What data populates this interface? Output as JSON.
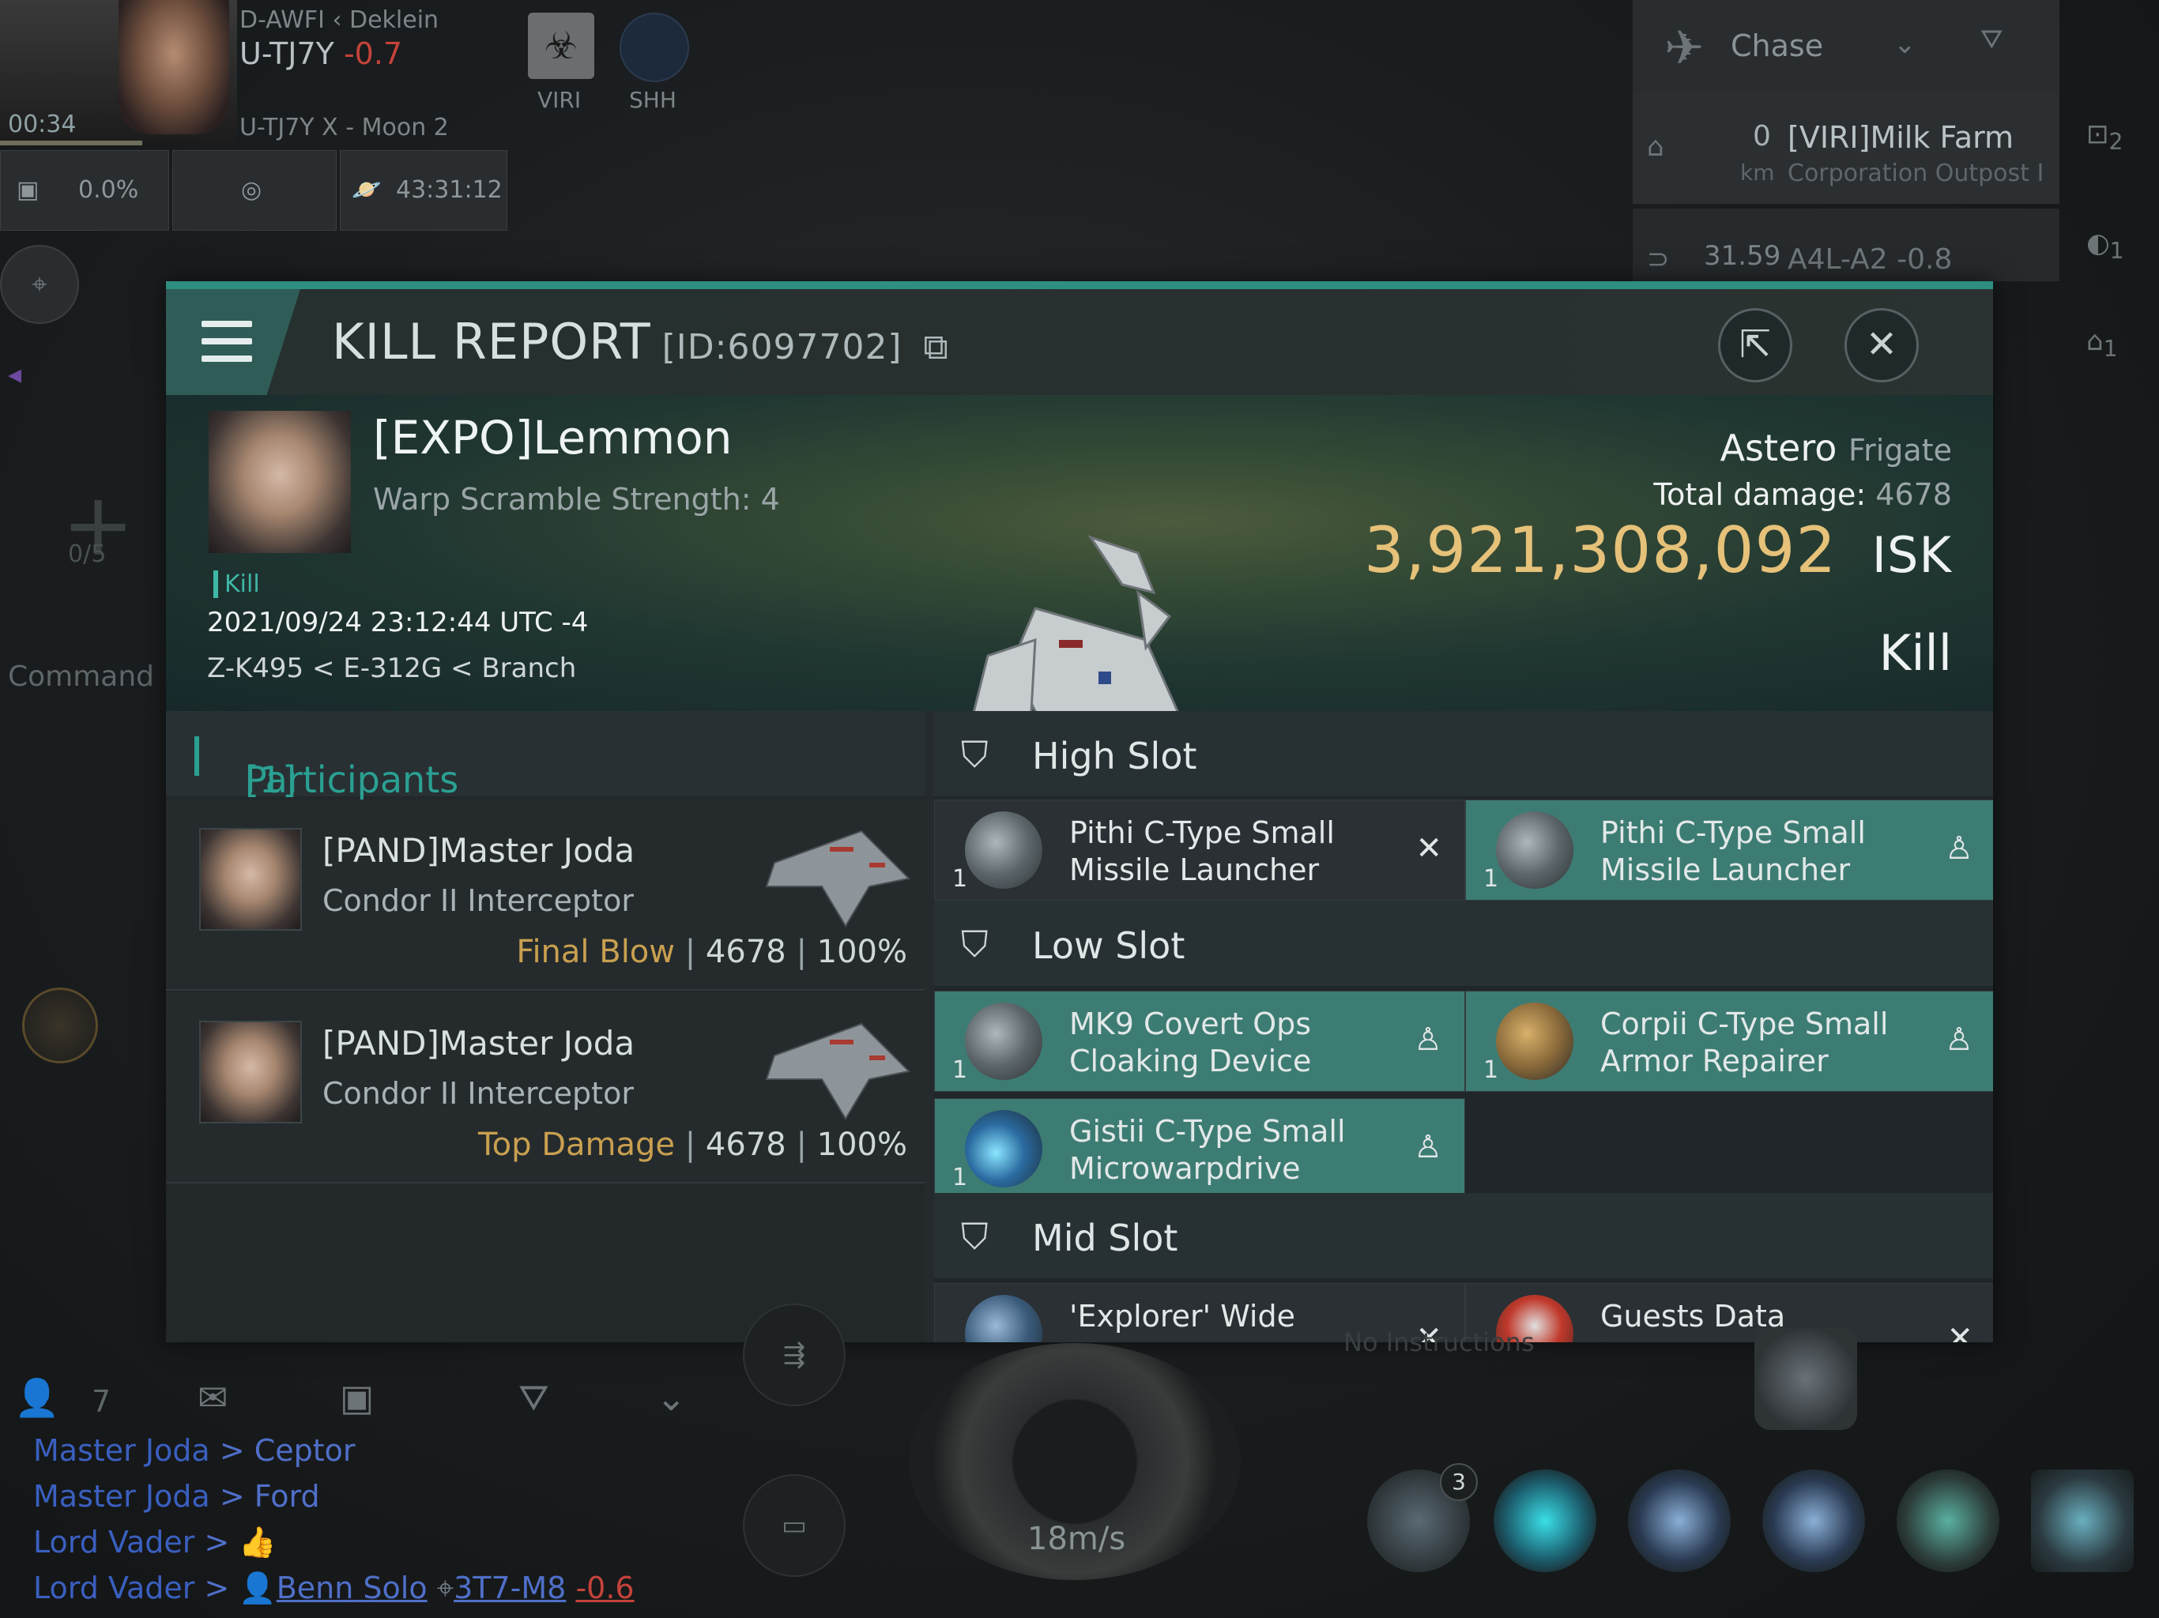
{
  "hud": {
    "region_prev": "D-AWFI",
    "region_next": "Deklein",
    "system": "U-TJ7Y",
    "security": "-0.7",
    "timer": "00:34",
    "location": "U-TJ7Y X - Moon 2",
    "cargo_pct": "0.0%",
    "session_time": "43:31:12",
    "tag1": "VIRI",
    "tag2": "SHH",
    "plus_count": "0/5",
    "command_label": "Command"
  },
  "right_hud": {
    "mode": "Chase",
    "target1_dist": "0",
    "target1_unit": "km",
    "target1_name": "[VIRI]Milk Farm",
    "target1_type": "Corporation Outpost I",
    "target2_dist": "31.59",
    "target2_name": "A4L-A2 -0.8",
    "badge1": "2",
    "badge2": "1",
    "badge3": "1"
  },
  "kill_report": {
    "title": "KILL REPORT",
    "id_text": "[ID:6097702]",
    "victim": {
      "name": "[EXPO]Lemmon",
      "warp_scramble": "Warp Scramble Strength: 4",
      "tag": "Kill",
      "datetime": "2021/09/24 23:12:44 UTC -4",
      "location": "Z-K495 < E-312G < Branch"
    },
    "ship": {
      "name": "Astero",
      "class": "Frigate",
      "total_damage_label": "Total damage:",
      "total_damage": "4678",
      "value": "3,921,308,092",
      "currency": "ISK",
      "result": "Kill"
    },
    "participants": {
      "label": "Participants",
      "count": "[1]",
      "rows": [
        {
          "name": "[PAND]Master Joda",
          "ship": "Condor II Interceptor",
          "role": "Final Blow",
          "damage": "4678",
          "pct": "100%"
        },
        {
          "name": "[PAND]Master Joda",
          "ship": "Condor II Interceptor",
          "role": "Top Damage",
          "damage": "4678",
          "pct": "100%"
        }
      ]
    },
    "slots": {
      "high": {
        "label": "High Slot",
        "modules": [
          {
            "line1": "Pithi C-Type Small",
            "line2": "Missile Launcher",
            "count": "1",
            "state": "destroyed"
          },
          {
            "line1": "Pithi C-Type Small",
            "line2": "Missile Launcher",
            "count": "1",
            "state": "dropped"
          }
        ]
      },
      "low": {
        "label": "Low Slot",
        "modules": [
          {
            "line1": "MK9 Covert Ops",
            "line2": "Cloaking Device",
            "count": "1",
            "state": "dropped"
          },
          {
            "line1": "Corpii C-Type Small",
            "line2": "Armor Repairer",
            "count": "1",
            "state": "dropped"
          },
          {
            "line1": "Gistii C-Type Small",
            "line2": "Microwarpdrive",
            "count": "1",
            "state": "dropped"
          }
        ]
      },
      "mid": {
        "label": "Mid Slot",
        "modules": [
          {
            "line1": "'Explorer' Wide",
            "line2": "",
            "count": "",
            "state": "destroyed"
          },
          {
            "line1": "Guests Data",
            "line2": "",
            "count": "",
            "state": "destroyed"
          }
        ]
      }
    }
  },
  "bottom": {
    "member_count": "7",
    "no_instructions": "No Instructions",
    "speed": "18m/s",
    "module_badge": "3",
    "chat": [
      {
        "from": "Master Joda",
        "sep": ">",
        "to": "Ceptor"
      },
      {
        "from": "Master Joda",
        "sep": ">",
        "to": "Ford"
      },
      {
        "from": "Lord Vader",
        "sep": ">",
        "to": ""
      },
      {
        "from": "Lord Vader",
        "sep": ">",
        "to": "Benn Solo",
        "sys": "3T7-M8",
        "sec": "-0.6"
      }
    ]
  },
  "colors": {
    "accent_teal": "#2e8e80",
    "isk_gold": "#e6c179",
    "role_gold": "#c9a050",
    "dropped_teal": "#3d7c73"
  }
}
